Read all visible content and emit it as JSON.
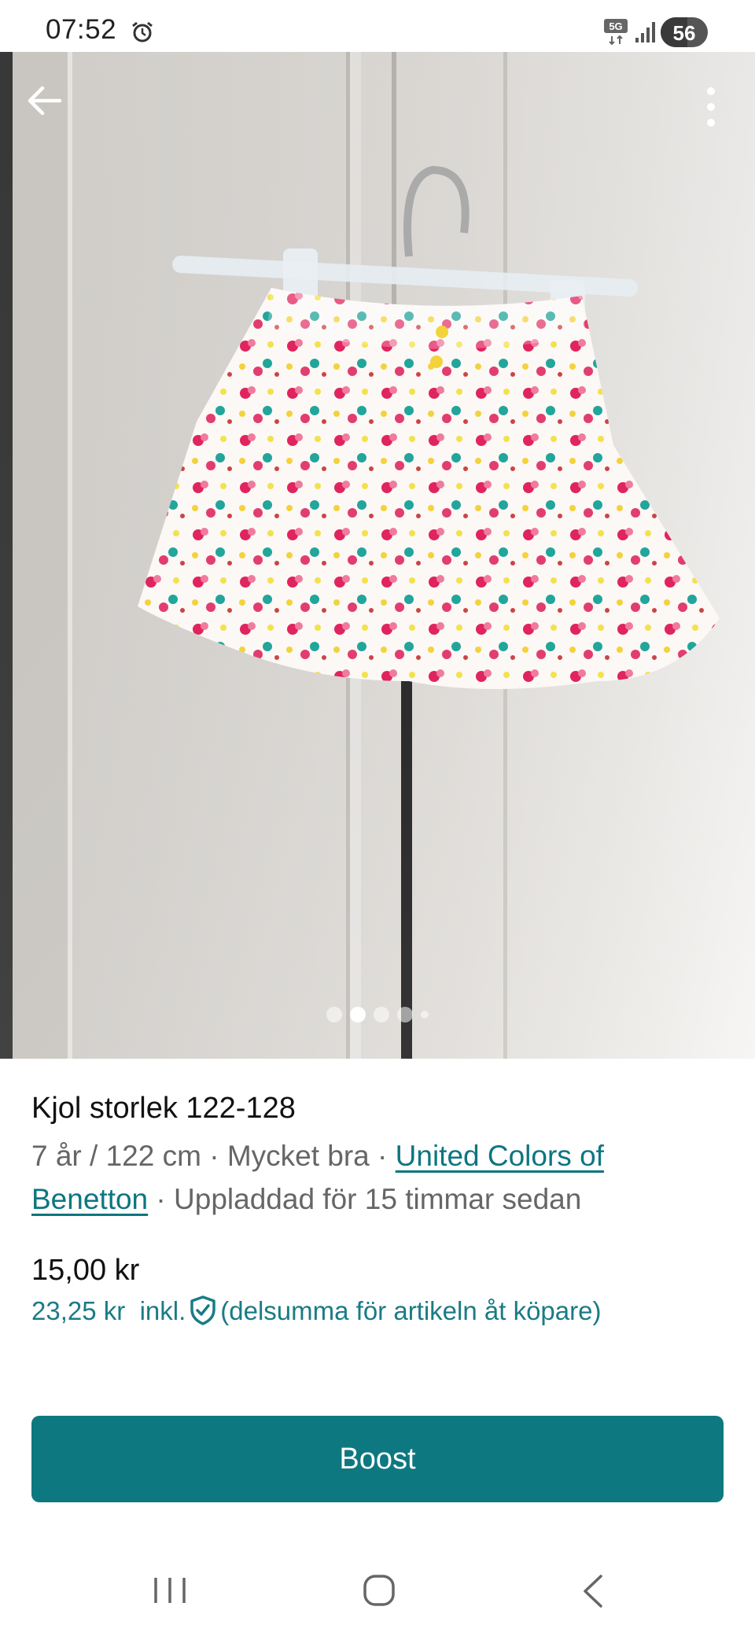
{
  "status_bar": {
    "time": "07:52",
    "network": "5G",
    "battery": "56",
    "battery_level_percent": 56,
    "icons": [
      "alarm-icon",
      "network-5g-icon",
      "signal-icon",
      "battery-icon"
    ]
  },
  "gallery": {
    "image_count": 5,
    "active_index": 1,
    "image_subject": "white floral children's skirt on a clear plastic hanger"
  },
  "listing": {
    "title": "Kjol storlek 122-128",
    "size": "7 år / 122 cm",
    "sep1": " · ",
    "condition": "Mycket bra",
    "sep2": " · ",
    "brand": "United Colors of Benetton",
    "sep3": " · ",
    "uploaded": "Uppladdad för 15 timmar sedan",
    "price": "15,00 kr",
    "price_incl": "23,25 kr",
    "incl_label": "inkl.",
    "incl_note": "(delsumma för artikeln åt köpare)"
  },
  "actions": {
    "boost_label": "Boost"
  },
  "colors": {
    "accent": "#0e7880",
    "link": "#0d7680",
    "price_incl": "#1a7b86"
  }
}
